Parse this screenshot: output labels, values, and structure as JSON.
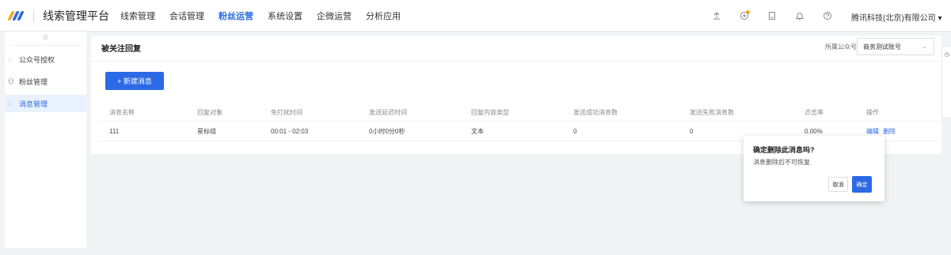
{
  "header": {
    "app_title": "线索管理平台",
    "nav": [
      {
        "label": "线索管理",
        "active": false
      },
      {
        "label": "会话管理",
        "active": false
      },
      {
        "label": "粉丝运营",
        "active": true
      },
      {
        "label": "系统设置",
        "active": false
      },
      {
        "label": "企微运营",
        "active": false
      },
      {
        "label": "分析应用",
        "active": false
      }
    ],
    "icons": [
      "upload-icon",
      "notification-badge-icon",
      "document-icon",
      "bell-icon",
      "help-icon"
    ],
    "company": "腾讯科技(北京)有限公司"
  },
  "sidebar": {
    "items": [
      {
        "label": "公众号授权",
        "icon": "chat-bubble-icon",
        "active": false
      },
      {
        "label": "粉丝管理",
        "icon": "user-icon",
        "active": false
      },
      {
        "label": "消息管理",
        "icon": "message-icon",
        "active": true
      }
    ]
  },
  "main": {
    "title": "被关注回复",
    "account_label": "所属公众号",
    "account_value": "商务测试账号",
    "new_button": "+ 新建消息",
    "columns": [
      "消息名称",
      "回复对象",
      "免打扰时间",
      "发送延迟时间",
      "回复内容类型",
      "发送成功消息数",
      "发送失败消息数",
      "点击率",
      "操作"
    ],
    "rows": [
      {
        "name": "111",
        "target": "星标组",
        "quiet_time": "00:01 - 02:03",
        "delay": "0小时0分0秒",
        "content_type": "文本",
        "success": "0",
        "fail": "0",
        "ctr": "0.00%",
        "edit": "编辑",
        "delete": "删除"
      }
    ]
  },
  "popconfirm": {
    "title": "确定删除此消息吗?",
    "description": "消息删除后不可恢复",
    "cancel": "取消",
    "ok": "确定"
  },
  "colors": {
    "accent": "#2c6ae5",
    "logo_yellow": "#f5a623"
  }
}
